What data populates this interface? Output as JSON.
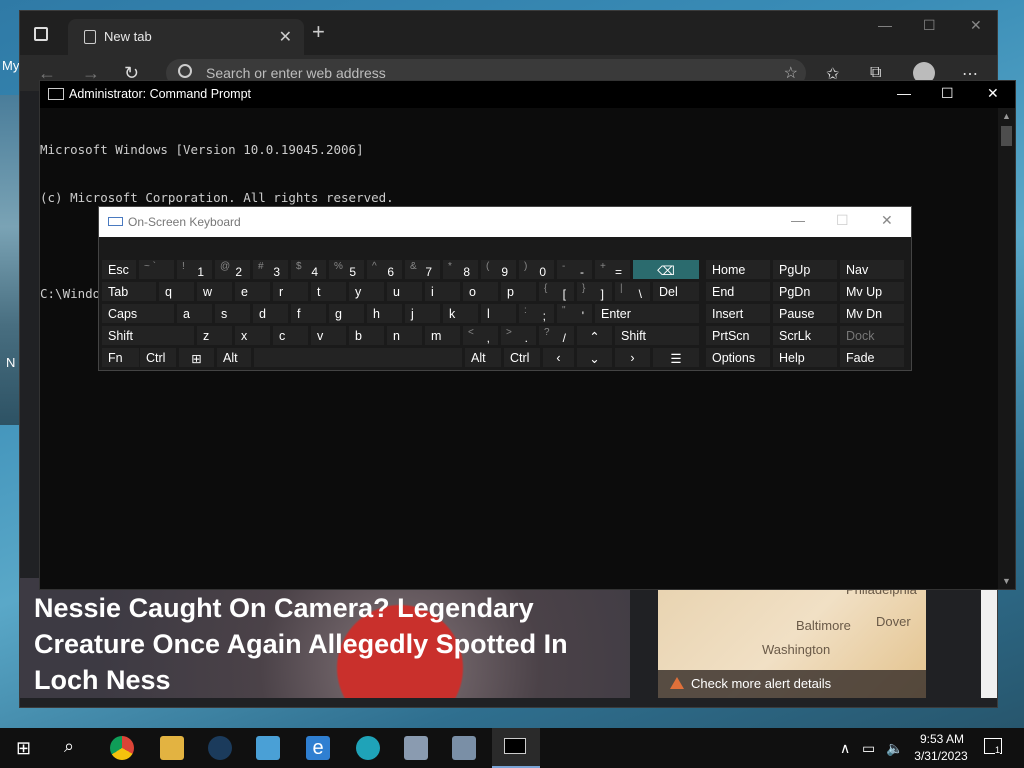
{
  "desktop": {
    "label_my": "My",
    "label_n": "N"
  },
  "browser": {
    "tab_title": "New tab",
    "address_placeholder": "Search or enter web address",
    "news_headline": "Nessie Caught On Camera? Legendary Creature Once Again Allegedly Spotted In Loch Ness",
    "map_cities": [
      "Philadelphia",
      "Baltimore",
      "Dover",
      "Washington"
    ],
    "map_alert": "Check more alert details"
  },
  "cmd": {
    "title": "Administrator: Command Prompt",
    "lines": [
      "Microsoft Windows [Version 10.0.19045.2006]",
      "(c) Microsoft Corporation. All rights reserved.",
      "",
      "C:\\Windows\\system32>"
    ]
  },
  "osk": {
    "title": "On-Screen Keyboard",
    "keys": {
      "esc": "Esc",
      "tab": "Tab",
      "caps": "Caps",
      "shift": "Shift",
      "fn": "Fn",
      "ctrl": "Ctrl",
      "alt": "Alt",
      "enter": "Enter",
      "del": "Del",
      "shift_r": "Shift",
      "alt_r": "Alt",
      "ctrl_r": "Ctrl",
      "home": "Home",
      "pgup": "PgUp",
      "nav": "Nav",
      "end": "End",
      "pgdn": "PgDn",
      "mvup": "Mv Up",
      "insert": "Insert",
      "pause": "Pause",
      "mvdn": "Mv Dn",
      "prtscn": "PrtScn",
      "scrlk": "ScrLk",
      "dock": "Dock",
      "options": "Options",
      "help": "Help",
      "fade": "Fade"
    },
    "row1": [
      [
        "~ `",
        ""
      ],
      [
        "!",
        "1"
      ],
      [
        "@",
        "2"
      ],
      [
        "#",
        "3"
      ],
      [
        "$",
        "4"
      ],
      [
        "%",
        "5"
      ],
      [
        "^",
        "6"
      ],
      [
        "&",
        "7"
      ],
      [
        "*",
        "8"
      ],
      [
        "(",
        "9"
      ],
      [
        ")",
        "0"
      ],
      [
        "-",
        "-"
      ],
      [
        "+",
        "="
      ]
    ],
    "row2": [
      "q",
      "w",
      "e",
      "r",
      "t",
      "y",
      "u",
      "i",
      "o",
      "p"
    ],
    "row2b": [
      [
        "{",
        "["
      ],
      [
        "}",
        "]"
      ],
      [
        "|",
        "\\"
      ]
    ],
    "row3": [
      "a",
      "s",
      "d",
      "f",
      "g",
      "h",
      "j",
      "k",
      "l"
    ],
    "row3b": [
      [
        ":",
        ";"
      ],
      [
        "\"",
        "'"
      ]
    ],
    "row4": [
      "z",
      "x",
      "c",
      "v",
      "b",
      "n",
      "m"
    ],
    "row4b": [
      [
        "<",
        ","
      ],
      [
        ">",
        "."
      ],
      [
        "?",
        "/"
      ]
    ]
  },
  "taskbar": {
    "time": "9:53 AM",
    "date": "3/31/2023",
    "notifications": "1"
  }
}
